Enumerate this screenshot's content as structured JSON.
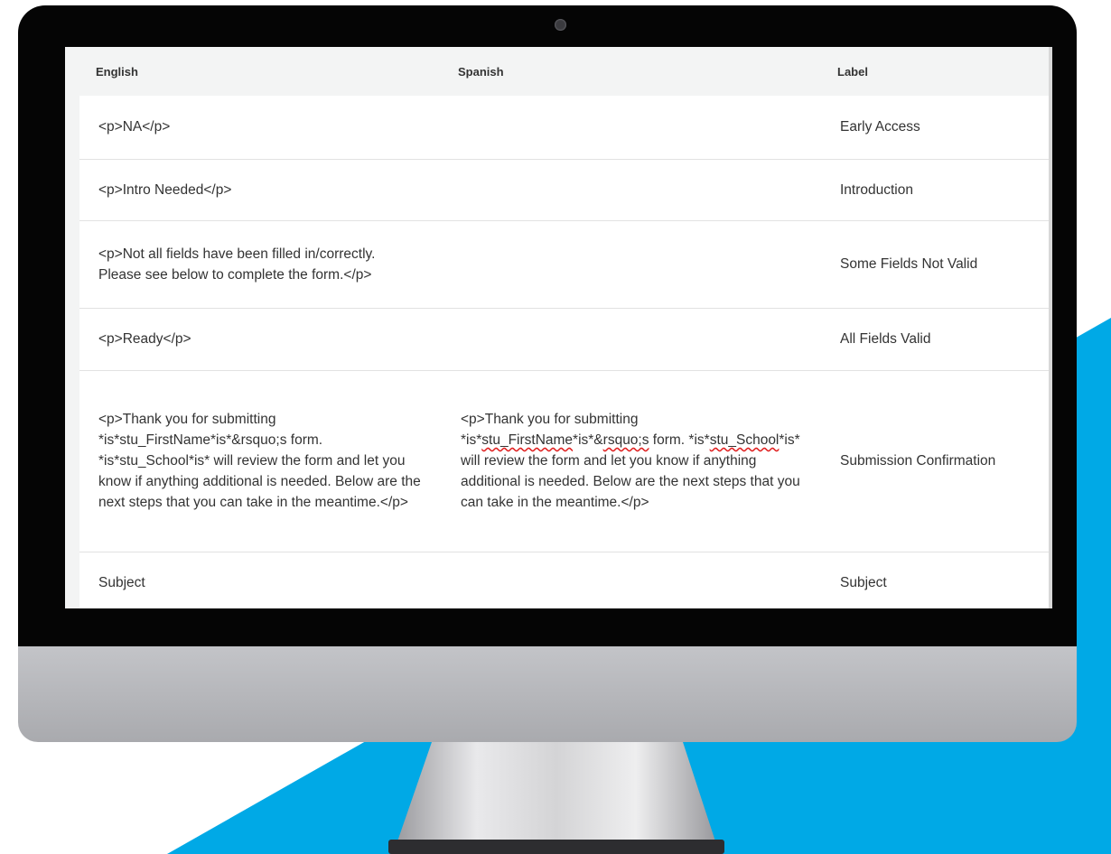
{
  "colors": {
    "accent_blue": "#00a9e6",
    "bezel": "#050505",
    "screen_header_bg": "#f3f4f4",
    "spell_error": "#e02020"
  },
  "table": {
    "headers": {
      "english": "English",
      "spanish": "Spanish",
      "label": "Label"
    },
    "rows": [
      {
        "english": "<p>NA</p>",
        "spanish": "",
        "label": "Early Access"
      },
      {
        "english": "<p>Intro Needed</p>",
        "spanish": "",
        "label": "Introduction"
      },
      {
        "english": "<p>Not all fields have been filled in/correctly. Please see below to complete the form.</p>",
        "spanish": "",
        "label": "Some Fields Not Valid"
      },
      {
        "english": "<p>Ready</p>",
        "spanish": "",
        "label": "All Fields Valid"
      },
      {
        "english": "<p>Thank you for submitting *is*stu_FirstName*is*&rsquo;s form. *is*stu_School*is* will review the form and let you know if anything additional is needed. Below are the next steps that you can take in the meantime.</p>",
        "spanish": {
          "part1": "<p>Thank you for submitting *is*",
          "misspelled1": "stu_FirstName",
          "part2": "*is*&",
          "misspelled2": "rsquo;s",
          "part3": " form. *is*",
          "misspelled3": "stu_School",
          "part4": "*is* will review the form and let you know if anything additional is needed. Below are the next steps that you can take in the meantime.</p>"
        },
        "label": "Submission Confirmation"
      },
      {
        "english": "Subject",
        "spanish": "",
        "label": "Subject"
      }
    ]
  }
}
